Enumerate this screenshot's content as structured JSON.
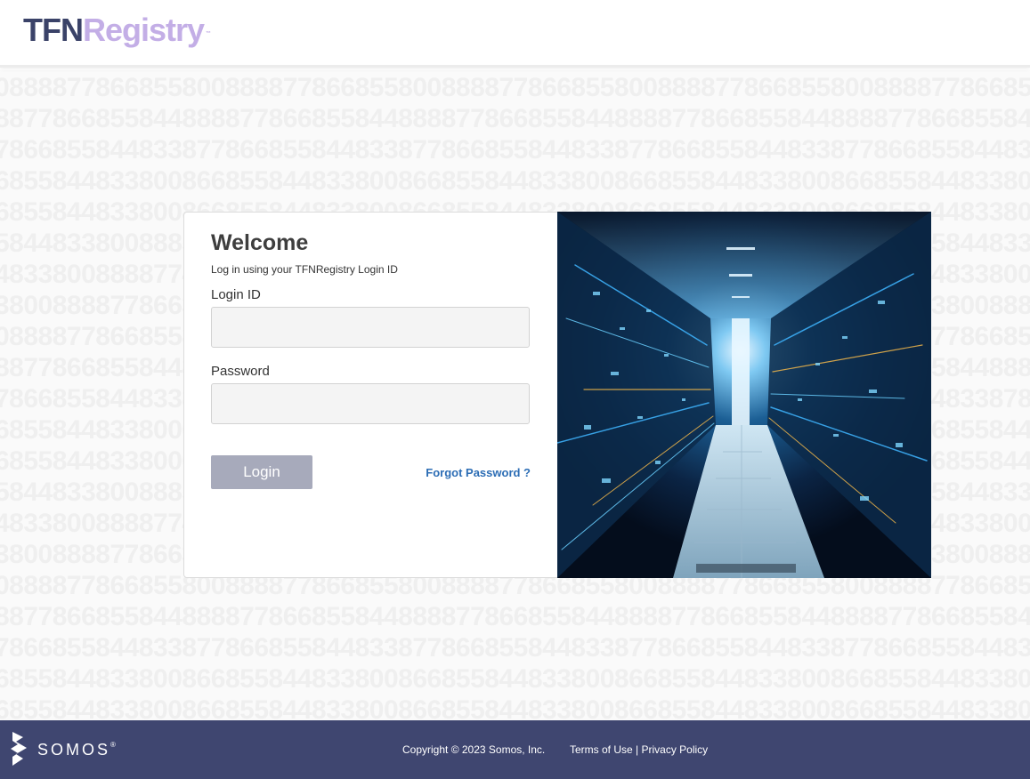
{
  "header": {
    "logo": {
      "part1": "TFN",
      "part2": "Registry",
      "tm": "™"
    }
  },
  "login": {
    "title": "Welcome",
    "subtitle": "Log in using your TFNRegistry Login ID",
    "login_id_label": "Login ID",
    "login_id_value": "",
    "password_label": "Password",
    "password_value": "",
    "login_button": "Login",
    "forgot_link": "Forgot Password ?"
  },
  "footer": {
    "brand": "SOMOS",
    "brand_mark": "®",
    "copyright": "Copyright © 2023 Somos, Inc.",
    "terms": "Terms of Use",
    "separator": "|",
    "privacy": "Privacy Policy"
  },
  "background_rows": [
    "088887786685580088887786685580088887786685580088887786685580088887786685580088887786",
    "887786685584488887786685584488887786685584488887786685584488887786685584488887786685",
    "786685584483387786685584483387786685584483387786685584483387786685584483387786685584",
    "685584483380086685584483380086685584483380086685584483380086685584483380086685584483",
    "685584483380086685584483380086685584483380086685584483380086685584483380086685584483",
    "584483380088858448338008885844833800888584483380088858448338008885844833800888584483",
    "483380088887748338008888774833800888877483380088887748338008888774833800888877483380",
    "380088887786638008888778663800888877866380088887786638008888778663800888877866380088",
    "088887786685580088887786685580088887786685580088887786685580088887786685580088887786",
    "887786685584488877866855844888778668558448887786685584488877866855844888778668558448",
    "786685584483387866855844833878668558448338786685584483387866855844833878668558448338",
    "685584483380068558448338006855844833800685584483380068558448338006855844833800685584",
    "685584483380068558448338006855844833800685584483380068558448338006855844833800685584",
    "584483380088858448338008885844833800888584483380088858448338008885844833800888584483",
    "483380088887748338008888774833800888877483380088887748338008888774833800888877483380",
    "380088887786638008888778663800888877866380088887786638008888778663800888877866380088",
    "088887786685580088887786685580088887786685580088887786685580088887786685580088887786",
    "887786685584488887786685584488887786685584488887786685584488887786685584488887786685",
    "786685584483387786685584483387786685584483387786685584483387786685584483387786685584",
    "685584483380086685584483380086685584483380086685584483380086685584483380086685584483",
    "685584483380086685584483380086685584483380086685584483380086685584483380086685584483"
  ]
}
